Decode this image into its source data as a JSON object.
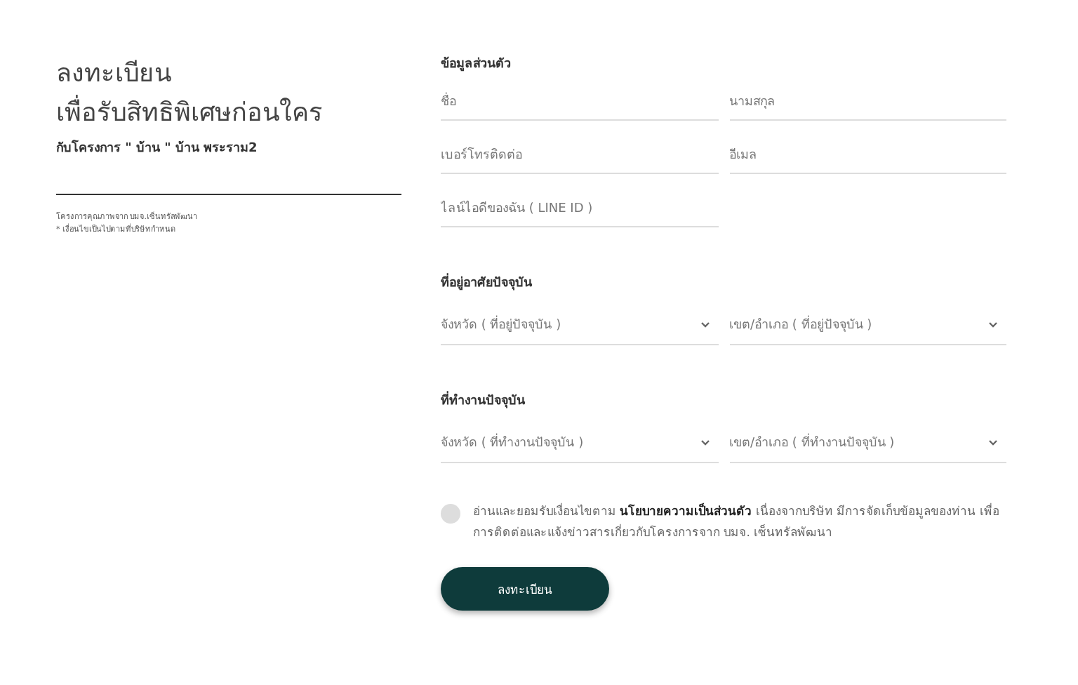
{
  "intro": {
    "title_lines": [
      "ลงทะเบียน",
      "เพื่อรับสิทธิพิเศษก่อนใคร"
    ],
    "subtitle": "กับโครงการ \" บ้าน \" บ้าน พระราม2",
    "notes": [
      "โครงการคุณภาพจาก บมจ.เซ็นทรัลพัฒนา",
      "* เงื่อนไขเป็นไปตามที่บริษัทกำหนด"
    ]
  },
  "sections": [
    {
      "heading": "ข้อมูลส่วนตัว",
      "fields": [
        {
          "kind": "input",
          "placeholder": "ชื่อ"
        },
        {
          "kind": "input",
          "placeholder": "นามสกุล"
        },
        {
          "kind": "input",
          "placeholder": "เบอร์โทรติดต่อ"
        },
        {
          "kind": "input",
          "placeholder": "อีเมล"
        },
        {
          "kind": "input",
          "placeholder": "ไลน์ไอดีของฉัน ( LINE ID )"
        }
      ]
    },
    {
      "heading": "ที่อยู่อาศัยปัจจุบัน",
      "fields": [
        {
          "kind": "select",
          "placeholder": "จังหวัด ( ที่อยู่ปัจจุบัน )"
        },
        {
          "kind": "select",
          "placeholder": "เขต/อำเภอ ( ที่อยู่ปัจจุบัน )"
        }
      ]
    },
    {
      "heading": "ที่ทำงานปัจจุบัน",
      "fields": [
        {
          "kind": "select",
          "placeholder": "จังหวัด ( ที่ทำงานปัจจุบัน )"
        },
        {
          "kind": "select",
          "placeholder": "เขต/อำเภอ ( ที่ทำงานปัจจุบัน )"
        }
      ]
    }
  ],
  "consent": {
    "checked": false,
    "text": "อ่านและยอมรับเงื่อนไขตาม **นโยบายความเป็นส่วนตัว** เนื่องจากบริษัท มีการจัดเก็บข้อมูลของท่าน เพื่อการติดต่อและแจ้งข่าวสารเกี่ยวกับโครงการจาก บมจ. เซ็นทรัลพัฒนา"
  },
  "submit": {
    "label": "ลงทะเบียน"
  }
}
